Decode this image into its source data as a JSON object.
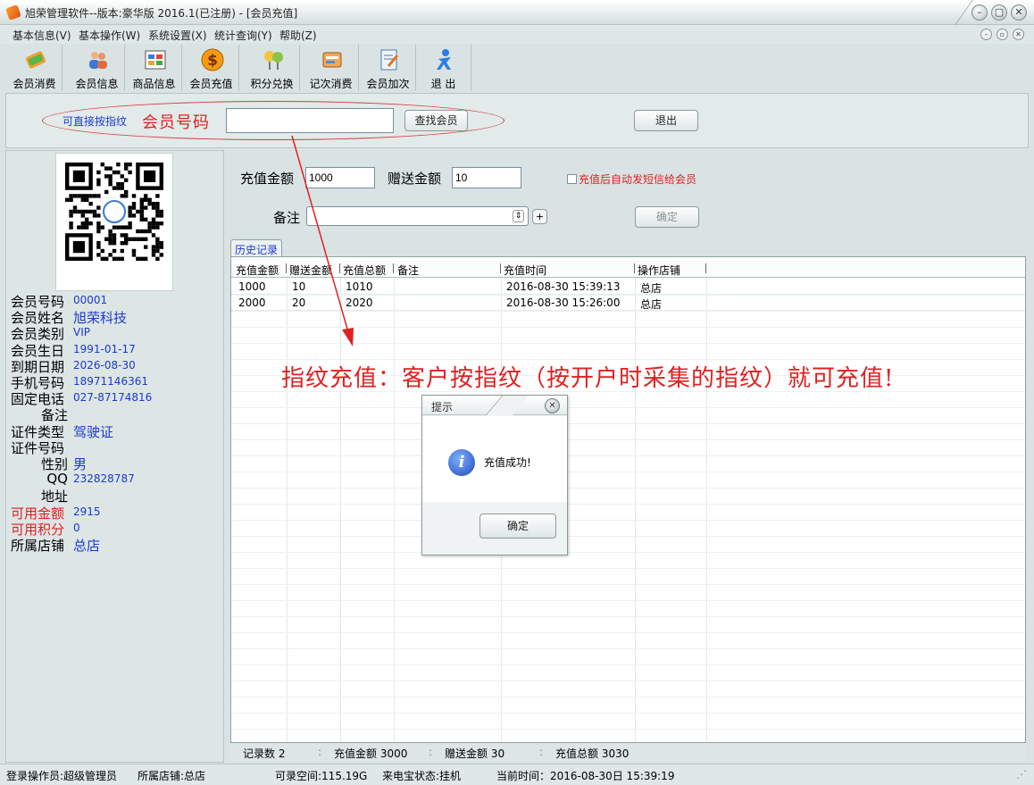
{
  "window": {
    "title": "旭荣管理软件--版本:豪华版 2016.1(已注册) - [会员充值]",
    "min_icon": "minimize-icon",
    "max_icon": "restore-icon",
    "close_icon": "close-icon"
  },
  "menu": [
    "基本信息(V)",
    "基本操作(W)",
    "系统设置(X)",
    "统计查询(Y)",
    "帮助(Z)"
  ],
  "toolbar": [
    {
      "label": "会员消费",
      "icon": "member-consume-icon"
    },
    {
      "label": "会员信息",
      "icon": "member-info-icon"
    },
    {
      "label": "商品信息",
      "icon": "product-info-icon"
    },
    {
      "label": "会员充值",
      "icon": "recharge-dollar-icon"
    },
    {
      "label": "积分兑换",
      "icon": "points-exchange-icon"
    },
    {
      "label": "记次消费",
      "icon": "count-consume-icon"
    },
    {
      "label": "会员加次",
      "icon": "add-count-icon"
    },
    {
      "label": "退 出",
      "icon": "exit-person-icon"
    }
  ],
  "search": {
    "hint": "可直接按指纹",
    "label": "会员号码",
    "value": "",
    "find_button": "查找会员",
    "exit_button": "退出"
  },
  "member": {
    "fields": [
      {
        "key": "会员号码",
        "value": "00001",
        "red": false,
        "big": false
      },
      {
        "key": "会员姓名",
        "value": "旭荣科技",
        "red": false,
        "big": true
      },
      {
        "key": "会员类别",
        "value": "VIP",
        "red": false,
        "big": false
      },
      {
        "key": "会员生日",
        "value": "1991-01-17",
        "red": false,
        "big": false
      },
      {
        "key": "到期日期",
        "value": "2026-08-30",
        "red": false,
        "big": false
      },
      {
        "key": "手机号码",
        "value": "18971146361",
        "red": false,
        "big": false
      },
      {
        "key": "固定电话",
        "value": "027-87174816",
        "red": false,
        "big": false
      },
      {
        "key": "备注",
        "value": "",
        "red": false,
        "big": false,
        "indent": true
      },
      {
        "key": "证件类型",
        "value": "驾驶证",
        "red": false,
        "big": true
      },
      {
        "key": "证件号码",
        "value": "",
        "red": false,
        "big": false
      },
      {
        "key": "性别",
        "value": "男",
        "red": false,
        "big": true,
        "indent": true
      },
      {
        "key": "QQ",
        "value": "232828787",
        "red": false,
        "big": false,
        "indent": true
      },
      {
        "key": "地址",
        "value": "",
        "red": false,
        "big": false,
        "indent": true
      },
      {
        "key": "可用金额",
        "value": "2915",
        "red": true,
        "big": false
      },
      {
        "key": "可用积分",
        "value": "0",
        "red": true,
        "big": false
      },
      {
        "key": "所属店铺",
        "value": "总店",
        "red": false,
        "big": true
      }
    ]
  },
  "form": {
    "recharge_label": "充值金额",
    "recharge_value": "1000",
    "gift_label": "赠送金额",
    "gift_value": "10",
    "sms_checkbox": "充值后自动发短信给会员",
    "remark_label": "备注",
    "confirm_button": "确定"
  },
  "history": {
    "tab": "历史记录",
    "columns": [
      "充值金额",
      "赠送金额",
      "充值总额",
      "备注",
      "充值时间",
      "操作店铺"
    ],
    "rows": [
      [
        "1000",
        "10",
        "1010",
        "",
        "2016-08-30 15:39:13",
        "总店"
      ],
      [
        "2000",
        "20",
        "2020",
        "",
        "2016-08-30 15:26:00",
        "总店"
      ]
    ]
  },
  "summary": {
    "count": "记录数 2",
    "recharge_total": "充值金额 3000",
    "gift_total": "赠送金额 30",
    "grand_total": "充值总额 3030"
  },
  "annotation": "指纹充值：客户按指纹（按开户时采集的指纹）就可充值!",
  "dialog": {
    "title": "提示",
    "message": "充值成功!",
    "ok_button": "确定"
  },
  "status": {
    "operator": "登录操作员:超级管理员",
    "store": "所属店铺:总店",
    "space": "可录空间:115.19G",
    "device": "来电宝状态:挂机",
    "time": "当前时间：2016-08-30日 15:39:19"
  }
}
